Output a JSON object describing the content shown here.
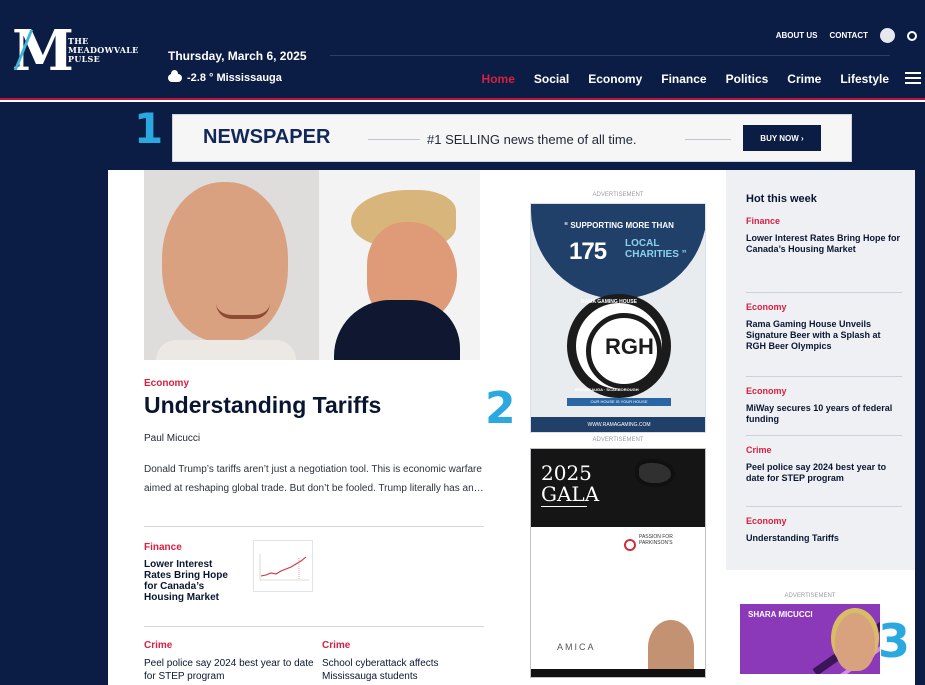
{
  "site": {
    "logo_letter": "M",
    "logo_name": "THE\nMEADOWVALE\nPULSE",
    "date": "Thursday, March 6, 2025",
    "weather": "-2.8 ° Mississauga",
    "utility_links": [
      "ABOUT US",
      "CONTACT"
    ],
    "nav": [
      "Home",
      "Social",
      "Economy",
      "Finance",
      "Politics",
      "Crime",
      "Lifestyle"
    ],
    "colors": {
      "navy": "#0b1d44",
      "accent": "#d81f3f",
      "highlight_blue": "#2aa8e0"
    }
  },
  "banner": {
    "badge": "1",
    "title": "NEWSPAPER",
    "tagline": "#1 SELLING news theme of all time.",
    "button": "BUY NOW ›"
  },
  "feature": {
    "category": "Economy",
    "title": "Understanding Tariffs",
    "author": "Paul Micucci",
    "excerpt": "Donald Trump’s tariffs aren’t just a negotiation tool. This is economic warfare aimed at reshaping global trade. But don’t be fooled. Trump literally has an…"
  },
  "small_story": {
    "category": "Finance",
    "title": "Lower Interest Rates Bring Hope for Canada’s Housing Market"
  },
  "bottom_stories": [
    {
      "category": "Crime",
      "title": "Peel police say 2024 best year to date for STEP program"
    },
    {
      "category": "Crime",
      "title": "School cyberattack affects Mississauga students"
    }
  ],
  "ads": {
    "label": "ADVERTISEMENT",
    "badge_2": "2",
    "badge_3": "3",
    "rgh": {
      "supporting": "“ SUPPORTING MORE THAN",
      "number": "175",
      "local": "LOCAL\nCHARITIES ”",
      "code": "RGH",
      "name": "RAMA GAMING HOUSE",
      "place": "MISSISSAUGA · SCARBOROUGH",
      "tagline": "OUR HOUSE IS YOUR HOUSE",
      "url": "WWW.RAMAGAMING.COM"
    },
    "gala": {
      "year": "2025",
      "word": "GALA",
      "partner": "PASSION FOR PARKINSON’S",
      "brand": "AMICA"
    },
    "side": {
      "name": "SHARA MICUCCI"
    }
  },
  "sidebar": {
    "heading": "Hot this week",
    "items": [
      {
        "category": "Finance",
        "title": "Lower Interest Rates Bring Hope for Canada’s Housing Market"
      },
      {
        "category": "Economy",
        "title": "Rama Gaming House Unveils Signature Beer with a Splash at RGH Beer Olympics"
      },
      {
        "category": "Economy",
        "title": "MiWay secures 10 years of federal funding"
      },
      {
        "category": "Crime",
        "title": "Peel police say 2024 best year to date for STEP program"
      },
      {
        "category": "Economy",
        "title": "Understanding Tariffs"
      }
    ]
  }
}
